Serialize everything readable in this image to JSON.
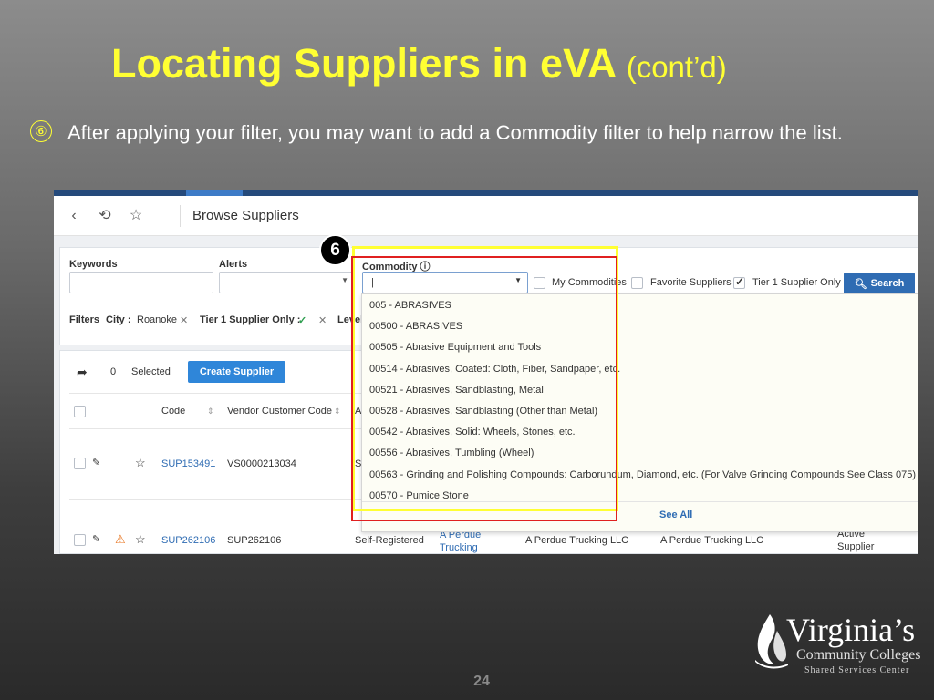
{
  "slide": {
    "title_main": "Locating Suppliers in eVA",
    "title_sub": "(cont’d)",
    "step_marker": "⑥",
    "step_text": "After applying your filter, you may want to add a Commodity filter to help narrow the list.",
    "page_number": "24",
    "badge": "6"
  },
  "logo": {
    "main": "Virginia’s",
    "sub": "Community Colleges",
    "sub2": "Shared Services Center"
  },
  "app": {
    "page_title": "Browse Suppliers",
    "filters": {
      "keywords_label": "Keywords",
      "alerts_label": "Alerts",
      "commodity_label": "Commodity ⓘ",
      "commodity_value": "|",
      "my_commodities_label": "My Commodities",
      "favorite_suppliers_label": "Favorite Suppliers",
      "tier1_label": "Tier 1 Supplier Only",
      "search_label": "Search",
      "applied_prefix": "Filters",
      "city_label": "City :",
      "city_value": "Roanoke",
      "tier1_chip_label": "Tier 1 Supplier Only :",
      "level_label": "Level"
    },
    "list": {
      "selected_count": "0",
      "selected_label": "Selected",
      "create_label": "Create Supplier",
      "columns": [
        "Code",
        "Vendor Customer Code",
        "A"
      ],
      "rows": [
        {
          "code": "SUP153491",
          "vendor_code": "VS0000213034",
          "col3": "Se"
        },
        {
          "code": "SUP262106",
          "vendor_code": "SUP262106",
          "col3": "Self-Registered",
          "col4": "A Perdue Trucking LLC",
          "col5": "A Perdue Trucking LLC",
          "col6": "A Perdue Trucking LLC",
          "col7a": "Active",
          "col7b": "Supplier"
        }
      ]
    },
    "commodity_options": [
      "005 - ABRASIVES",
      "00500 - ABRASIVES",
      "00505 - Abrasive Equipment and Tools",
      "00514 - Abrasives, Coated: Cloth, Fiber, Sandpaper, etc.",
      "00521 - Abrasives, Sandblasting, Metal",
      "00528 - Abrasives, Sandblasting (Other than Metal)",
      "00542 - Abrasives, Solid: Wheels, Stones, etc.",
      "00556 - Abrasives, Tumbling (Wheel)",
      "00563 - Grinding and Polishing Compounds: Carborundum, Diamond, etc. (For Valve Grinding Compounds See Class 075)",
      "00570 - Pumice Stone"
    ],
    "see_all_label": "See All"
  }
}
